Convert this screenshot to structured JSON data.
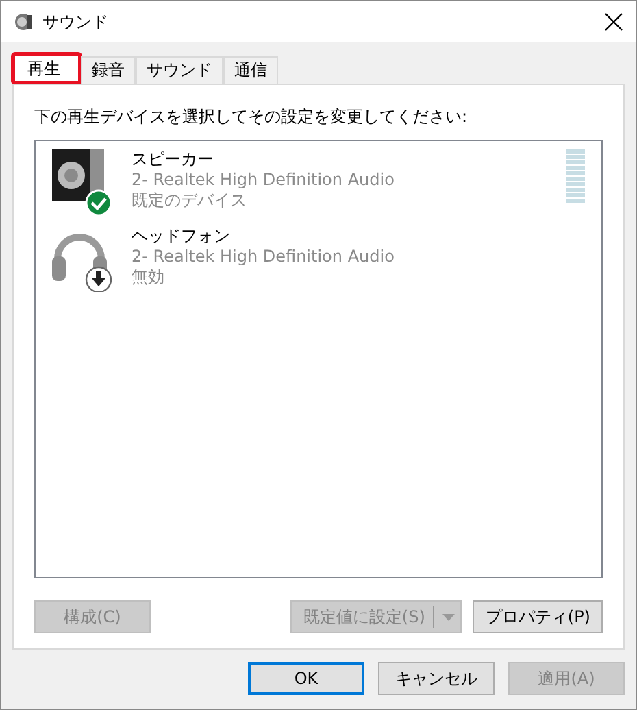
{
  "window": {
    "title": "サウンド"
  },
  "tabs": [
    {
      "label": "再生",
      "selected": true,
      "highlighted": true
    },
    {
      "label": "録音",
      "selected": false,
      "highlighted": false
    },
    {
      "label": "サウンド",
      "selected": false,
      "highlighted": false
    },
    {
      "label": "通信",
      "selected": false,
      "highlighted": false
    }
  ],
  "instruction": "下の再生デバイスを選択してその設定を変更してください:",
  "devices": [
    {
      "kind": "speaker",
      "name": "スピーカー",
      "driver": "2- Realtek High Definition Audio",
      "status": "既定のデバイス",
      "is_default": true,
      "disabled": false,
      "level": 0
    },
    {
      "kind": "headphones",
      "name": "ヘッドフォン",
      "driver": "2- Realtek High Definition Audio",
      "status": "無効",
      "is_default": false,
      "disabled": true
    }
  ],
  "panel_buttons": [
    {
      "kind": "plain",
      "label": "構成(C)",
      "disabled": true
    },
    {
      "kind": "split",
      "label": "既定値に設定(S)",
      "disabled": true
    },
    {
      "kind": "plain",
      "label": "プロパティ(P)",
      "disabled": false
    }
  ],
  "dialog_buttons": [
    {
      "label": "OK",
      "disabled": false,
      "default": true
    },
    {
      "label": "キャンセル",
      "disabled": false,
      "default": false
    },
    {
      "label": "適用(A)",
      "disabled": true,
      "default": false
    }
  ]
}
